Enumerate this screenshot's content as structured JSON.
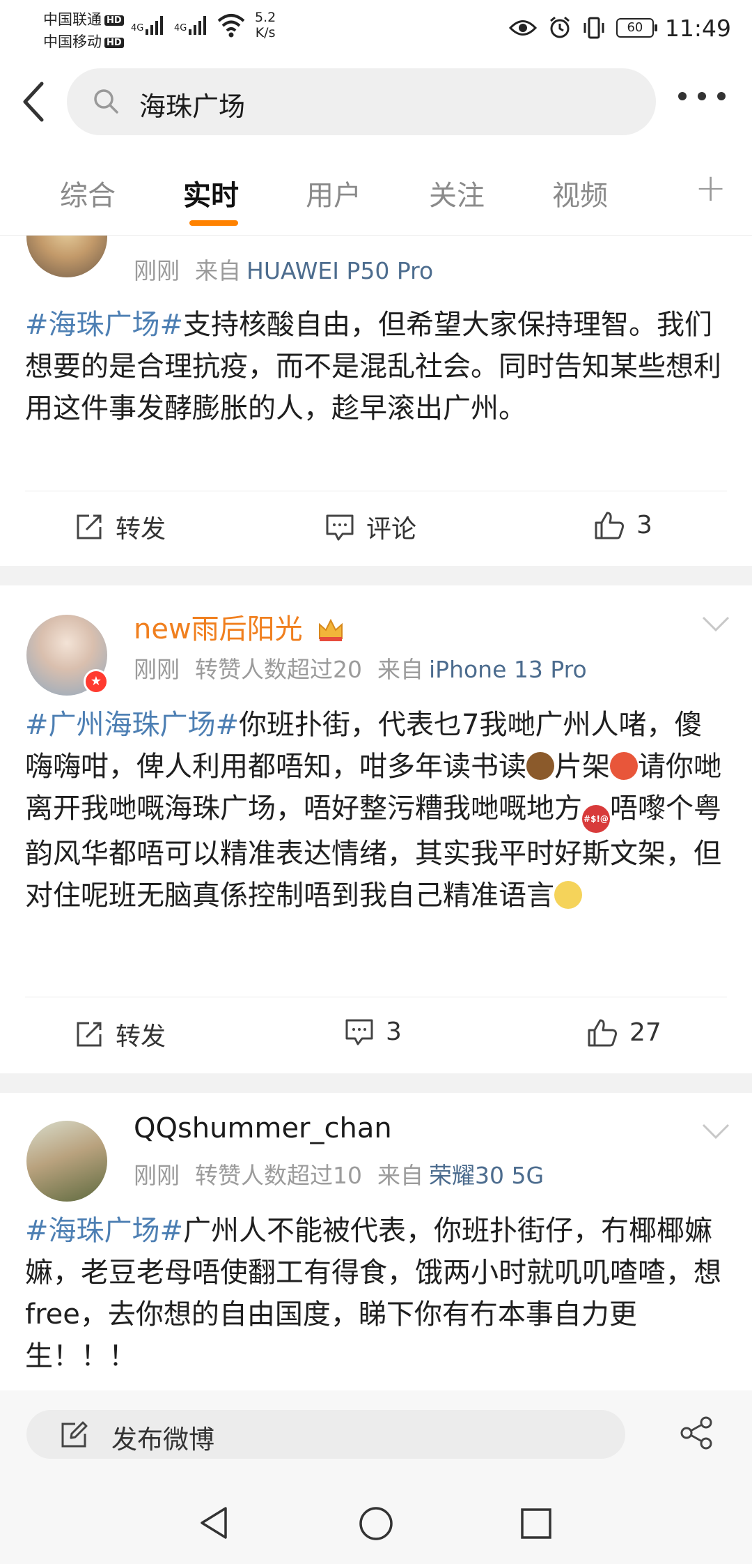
{
  "status_bar": {
    "carrier1": "中国联通",
    "carrier2": "中国移动",
    "hd": "HD",
    "network1": "4G",
    "network2": "4G",
    "speed_value": "5.2",
    "speed_unit": "K/s",
    "battery": "60",
    "time": "11:49"
  },
  "search": {
    "query": "海珠广场"
  },
  "tabs": [
    {
      "label": "综合"
    },
    {
      "label": "实时"
    },
    {
      "label": "用户"
    },
    {
      "label": "关注"
    },
    {
      "label": "视频"
    }
  ],
  "active_tab": "实时",
  "posts": [
    {
      "username": "",
      "time": "刚刚",
      "source_prefix": "来自",
      "device": "HUAWEI P50 Pro",
      "tag": "#海珠广场#",
      "text": "支持核酸自由，但希望大家保持理智。我们想要的是合理抗疫，而不是混乱社会。同时告知某些想利用这件事发酵膨胀的人，趁早滚出广州。",
      "repost_label": "转发",
      "comment_label": "评论",
      "likes": "3"
    },
    {
      "username": "new雨后阳光",
      "time": "刚刚",
      "reposts_note": "转赞人数超过20",
      "source_prefix": "来自",
      "device": "iPhone 13 Pro",
      "tag": "#广州海珠广场#",
      "text_1": "你班扑街，代表乜7我哋广州人啫，傻嗨嗨咁，俾人利用都唔知，咁多年读书读",
      "text_2": "片架",
      "text_3": "请你哋离开我哋嘅海珠广场，唔好整污糟我哋嘅地方",
      "text_4": "唔嚟个粤韵风华都唔可以精准表达情绪，其实我平时好斯文架，但对住呢班无脑真係控制唔到我自己精准语言",
      "repost_label": "转发",
      "comments": "3",
      "likes": "27"
    },
    {
      "username": "QQshummer_chan",
      "time": "刚刚",
      "reposts_note": "转赞人数超过10",
      "source_prefix": "来自",
      "device": "荣耀30 5G",
      "tag": "#海珠广场#",
      "text": "广州人不能被代表，你班扑街仔，冇椰椰嫲嫲，老豆老母唔使翻工有得食，饿两小时就叽叽喳喳，想free，去你想的自由国度，睇下你有冇本事自力更生！！！"
    }
  ],
  "compose": {
    "label": "发布微博"
  },
  "colors": {
    "accent": "#ff8200",
    "tag": "#4d7fb3",
    "vip_name": "#f07f1e",
    "device": "#4c6c8e",
    "meta": "#9b9b9b"
  }
}
